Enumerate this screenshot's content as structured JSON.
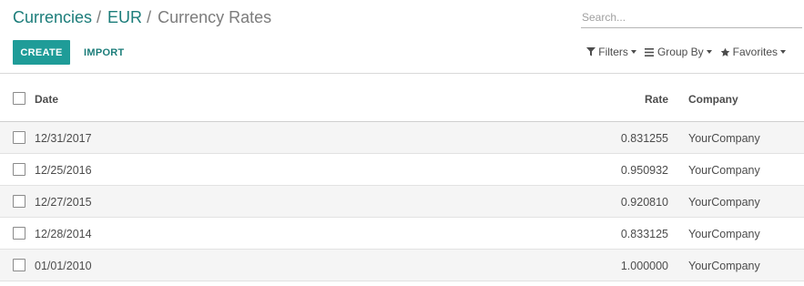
{
  "breadcrumb": {
    "items": [
      "Currencies",
      "EUR"
    ],
    "separator": "/",
    "current": "Currency Rates"
  },
  "search": {
    "placeholder": "Search...",
    "value": ""
  },
  "buttons": {
    "create": "CREATE",
    "import": "IMPORT"
  },
  "filters": {
    "filters_label": "Filters",
    "group_by_label": "Group By",
    "favorites_label": "Favorites",
    "filters_icon": "filter-icon",
    "group_by_icon": "list-icon",
    "favorites_icon": "star-icon"
  },
  "table": {
    "columns": {
      "date": "Date",
      "rate": "Rate",
      "company": "Company"
    },
    "rows": [
      {
        "date": "12/31/2017",
        "rate": "0.831255",
        "company": "YourCompany"
      },
      {
        "date": "12/25/2016",
        "rate": "0.950932",
        "company": "YourCompany"
      },
      {
        "date": "12/27/2015",
        "rate": "0.920810",
        "company": "YourCompany"
      },
      {
        "date": "12/28/2014",
        "rate": "0.833125",
        "company": "YourCompany"
      },
      {
        "date": "01/01/2010",
        "rate": "1.000000",
        "company": "YourCompany"
      }
    ]
  },
  "colors": {
    "accent": "#1f9c98",
    "link": "#1c7d7a",
    "text": "#4c4c4c",
    "muted": "#7c7c7c",
    "row_alt": "#f5f5f5"
  }
}
